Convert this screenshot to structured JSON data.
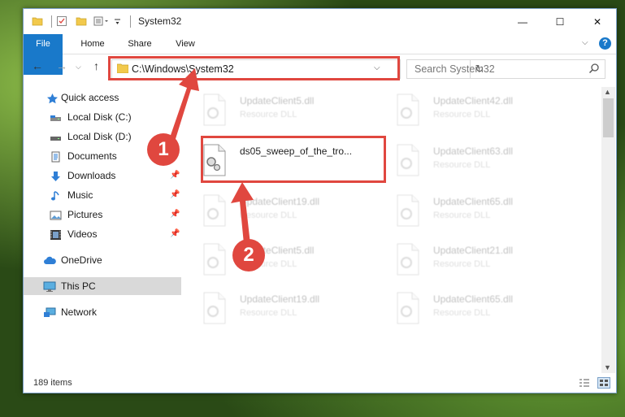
{
  "window": {
    "title": "System32",
    "controls": {
      "minimize": "—",
      "maximize": "☐",
      "close": "✕"
    }
  },
  "ribbon": {
    "tabs": [
      {
        "label": "File",
        "active": true
      },
      {
        "label": "Home"
      },
      {
        "label": "Share"
      },
      {
        "label": "View"
      }
    ],
    "help": "?"
  },
  "address": {
    "path": "C:\\Windows\\System32",
    "search_placeholder": "Search System32"
  },
  "sidebar": {
    "items": [
      {
        "label": "Quick access",
        "icon": "star-icon"
      },
      {
        "label": "Local Disk (C:)",
        "icon": "drive-icon"
      },
      {
        "label": "Local Disk (D:)",
        "icon": "drive-icon"
      },
      {
        "label": "Documents",
        "icon": "documents-icon"
      },
      {
        "label": "Downloads",
        "icon": "download-icon",
        "pinned": true
      },
      {
        "label": "Music",
        "icon": "music-icon",
        "pinned": true
      },
      {
        "label": "Pictures",
        "icon": "pictures-icon",
        "pinned": true
      },
      {
        "label": "Videos",
        "icon": "videos-icon",
        "pinned": true
      },
      {
        "label": "OneDrive",
        "icon": "cloud-icon"
      },
      {
        "label": "This PC",
        "icon": "computer-icon",
        "selected": true
      },
      {
        "label": "Network",
        "icon": "network-icon"
      }
    ]
  },
  "files": [
    {
      "name": "UpdateClient5.dll",
      "desc": "Resource DLL"
    },
    {
      "name": "UpdateClient42.dll",
      "desc": "Resource DLL"
    },
    {
      "name": "ds05_sweep_of_the_tro...",
      "desc": ""
    },
    {
      "name": "UpdateClient63.dll",
      "desc": "Resource DLL"
    },
    {
      "name": "UpdateClient19.dll",
      "desc": "Resource DLL"
    },
    {
      "name": "UpdateClient65.dll",
      "desc": "Resource DLL"
    },
    {
      "name": "UpdateClient5.dll",
      "desc": "Resource DLL"
    },
    {
      "name": "UpdateClient21.dll",
      "desc": "Resource DLL"
    },
    {
      "name": "UpdateClient19.dll",
      "desc": "Resource DLL"
    },
    {
      "name": "UpdateClient65.dll",
      "desc": "Resource DLL"
    }
  ],
  "status": {
    "item_count": "189 items"
  },
  "annotations": {
    "step1": "1",
    "step2": "2",
    "color": "#e0473f"
  },
  "colors": {
    "accent": "#1979ca",
    "highlight": "#e0473f"
  }
}
